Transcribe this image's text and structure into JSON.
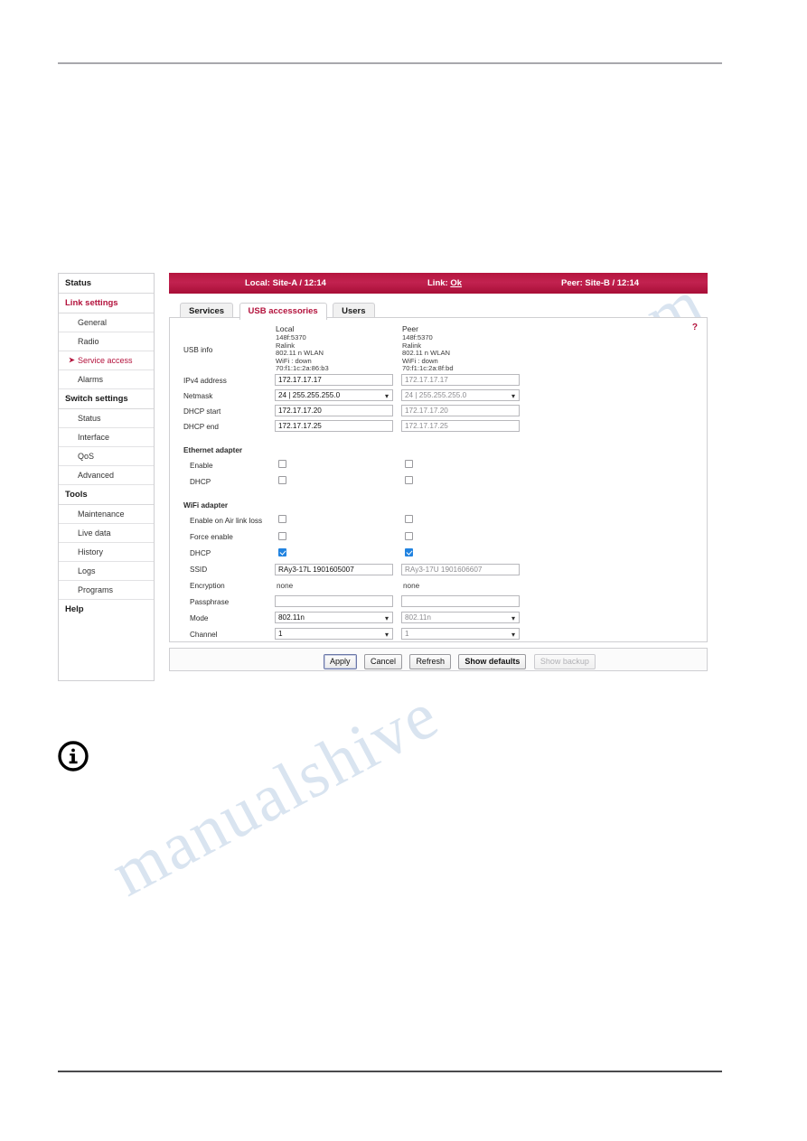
{
  "watermark": {
    "line1": "alshive.com",
    "line2": "manualshive"
  },
  "statusbar": {
    "local": "Local: Site-A / 12:14",
    "link_prefix": "Link: ",
    "link_value": "Ok",
    "peer": "Peer: Site-B / 12:14"
  },
  "sidebar": {
    "items": [
      {
        "label": "Status",
        "type": "group",
        "accent": false
      },
      {
        "label": "Link settings",
        "type": "group",
        "accent": true
      },
      {
        "label": "General",
        "type": "item",
        "current": false
      },
      {
        "label": "Radio",
        "type": "item",
        "current": false
      },
      {
        "label": "Service access",
        "type": "item",
        "current": true
      },
      {
        "label": "Alarms",
        "type": "item",
        "current": false
      },
      {
        "label": "Switch settings",
        "type": "group",
        "accent": false
      },
      {
        "label": "Status",
        "type": "item",
        "current": false
      },
      {
        "label": "Interface",
        "type": "item",
        "current": false
      },
      {
        "label": "QoS",
        "type": "item",
        "current": false
      },
      {
        "label": "Advanced",
        "type": "item",
        "current": false
      },
      {
        "label": "Tools",
        "type": "group",
        "accent": false
      },
      {
        "label": "Maintenance",
        "type": "item",
        "current": false
      },
      {
        "label": "Live data",
        "type": "item",
        "current": false
      },
      {
        "label": "History",
        "type": "item",
        "current": false
      },
      {
        "label": "Logs",
        "type": "item",
        "current": false
      },
      {
        "label": "Programs",
        "type": "item",
        "current": false
      },
      {
        "label": "Help",
        "type": "group",
        "accent": false
      }
    ]
  },
  "tabs": [
    {
      "label": "Services",
      "active": false
    },
    {
      "label": "USB accessories",
      "active": true
    },
    {
      "label": "Users",
      "active": false
    }
  ],
  "panel": {
    "help_label": "?",
    "columns": {
      "local": "Local",
      "peer": "Peer"
    },
    "labels": {
      "usb_info": "USB info",
      "ipv4_address": "IPv4 address",
      "netmask": "Netmask",
      "dhcp_start": "DHCP start",
      "dhcp_end": "DHCP end",
      "ethernet_adapter": "Ethernet adapter",
      "eth_enable": "Enable",
      "eth_dhcp": "DHCP",
      "wifi_adapter": "WiFi adapter",
      "enable_on_air_link_loss": "Enable on Air link loss",
      "force_enable": "Force enable",
      "wifi_dhcp": "DHCP",
      "ssid": "SSID",
      "encryption": "Encryption",
      "passphrase": "Passphrase",
      "mode": "Mode",
      "channel": "Channel"
    },
    "local": {
      "usb_info": "148f:5370\nRalink\n802.11 n WLAN\nWiFi : down\n70:f1:1c:2a:86:b3",
      "ipv4_address": "172.17.17.17",
      "netmask": "24  |  255.255.255.0",
      "dhcp_start": "172.17.17.20",
      "dhcp_end": "172.17.17.25",
      "eth_enable": false,
      "eth_dhcp": false,
      "enable_on_air_link_loss": false,
      "force_enable": false,
      "wifi_dhcp": true,
      "ssid": "RAy3-17L 1901605007",
      "encryption": "none",
      "passphrase": "",
      "mode": "802.11n",
      "channel": "1"
    },
    "peer": {
      "usb_info": "148f:5370\nRalink\n802.11 n WLAN\nWiFi : down\n70:f1:1c:2a:8f:bd",
      "ipv4_address": "172.17.17.17",
      "netmask": "24  |  255.255.255.0",
      "dhcp_start": "172.17.17.20",
      "dhcp_end": "172.17.17.25",
      "eth_enable": false,
      "eth_dhcp": false,
      "enable_on_air_link_loss": false,
      "force_enable": false,
      "wifi_dhcp": true,
      "ssid": "RAy3-17U 1901606607",
      "encryption": "none",
      "passphrase": "",
      "mode": "802.11n",
      "channel": "1"
    }
  },
  "footer": {
    "apply": "Apply",
    "cancel": "Cancel",
    "refresh": "Refresh",
    "show_defaults": "Show defaults",
    "show_backup": "Show backup"
  },
  "colors": {
    "brand": "#b3123c",
    "checkbox_on": "#2183e0",
    "border": "#cfcfd2"
  }
}
